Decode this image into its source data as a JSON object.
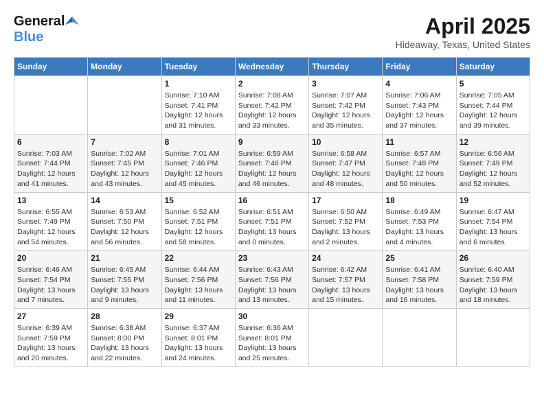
{
  "header": {
    "logo_general": "General",
    "logo_blue": "Blue",
    "month_title": "April 2025",
    "location": "Hideaway, Texas, United States"
  },
  "days_of_week": [
    "Sunday",
    "Monday",
    "Tuesday",
    "Wednesday",
    "Thursday",
    "Friday",
    "Saturday"
  ],
  "weeks": [
    [
      {
        "day": "",
        "info": ""
      },
      {
        "day": "",
        "info": ""
      },
      {
        "day": "1",
        "info": "Sunrise: 7:10 AM\nSunset: 7:41 PM\nDaylight: 12 hours\nand 31 minutes."
      },
      {
        "day": "2",
        "info": "Sunrise: 7:08 AM\nSunset: 7:42 PM\nDaylight: 12 hours\nand 33 minutes."
      },
      {
        "day": "3",
        "info": "Sunrise: 7:07 AM\nSunset: 7:42 PM\nDaylight: 12 hours\nand 35 minutes."
      },
      {
        "day": "4",
        "info": "Sunrise: 7:06 AM\nSunset: 7:43 PM\nDaylight: 12 hours\nand 37 minutes."
      },
      {
        "day": "5",
        "info": "Sunrise: 7:05 AM\nSunset: 7:44 PM\nDaylight: 12 hours\nand 39 minutes."
      }
    ],
    [
      {
        "day": "6",
        "info": "Sunrise: 7:03 AM\nSunset: 7:44 PM\nDaylight: 12 hours\nand 41 minutes."
      },
      {
        "day": "7",
        "info": "Sunrise: 7:02 AM\nSunset: 7:45 PM\nDaylight: 12 hours\nand 43 minutes."
      },
      {
        "day": "8",
        "info": "Sunrise: 7:01 AM\nSunset: 7:46 PM\nDaylight: 12 hours\nand 45 minutes."
      },
      {
        "day": "9",
        "info": "Sunrise: 6:59 AM\nSunset: 7:46 PM\nDaylight: 12 hours\nand 46 minutes."
      },
      {
        "day": "10",
        "info": "Sunrise: 6:58 AM\nSunset: 7:47 PM\nDaylight: 12 hours\nand 48 minutes."
      },
      {
        "day": "11",
        "info": "Sunrise: 6:57 AM\nSunset: 7:48 PM\nDaylight: 12 hours\nand 50 minutes."
      },
      {
        "day": "12",
        "info": "Sunrise: 6:56 AM\nSunset: 7:49 PM\nDaylight: 12 hours\nand 52 minutes."
      }
    ],
    [
      {
        "day": "13",
        "info": "Sunrise: 6:55 AM\nSunset: 7:49 PM\nDaylight: 12 hours\nand 54 minutes."
      },
      {
        "day": "14",
        "info": "Sunrise: 6:53 AM\nSunset: 7:50 PM\nDaylight: 12 hours\nand 56 minutes."
      },
      {
        "day": "15",
        "info": "Sunrise: 6:52 AM\nSunset: 7:51 PM\nDaylight: 12 hours\nand 58 minutes."
      },
      {
        "day": "16",
        "info": "Sunrise: 6:51 AM\nSunset: 7:51 PM\nDaylight: 13 hours\nand 0 minutes."
      },
      {
        "day": "17",
        "info": "Sunrise: 6:50 AM\nSunset: 7:52 PM\nDaylight: 13 hours\nand 2 minutes."
      },
      {
        "day": "18",
        "info": "Sunrise: 6:49 AM\nSunset: 7:53 PM\nDaylight: 13 hours\nand 4 minutes."
      },
      {
        "day": "19",
        "info": "Sunrise: 6:47 AM\nSunset: 7:54 PM\nDaylight: 13 hours\nand 6 minutes."
      }
    ],
    [
      {
        "day": "20",
        "info": "Sunrise: 6:46 AM\nSunset: 7:54 PM\nDaylight: 13 hours\nand 7 minutes."
      },
      {
        "day": "21",
        "info": "Sunrise: 6:45 AM\nSunset: 7:55 PM\nDaylight: 13 hours\nand 9 minutes."
      },
      {
        "day": "22",
        "info": "Sunrise: 6:44 AM\nSunset: 7:56 PM\nDaylight: 13 hours\nand 11 minutes."
      },
      {
        "day": "23",
        "info": "Sunrise: 6:43 AM\nSunset: 7:56 PM\nDaylight: 13 hours\nand 13 minutes."
      },
      {
        "day": "24",
        "info": "Sunrise: 6:42 AM\nSunset: 7:57 PM\nDaylight: 13 hours\nand 15 minutes."
      },
      {
        "day": "25",
        "info": "Sunrise: 6:41 AM\nSunset: 7:58 PM\nDaylight: 13 hours\nand 16 minutes."
      },
      {
        "day": "26",
        "info": "Sunrise: 6:40 AM\nSunset: 7:59 PM\nDaylight: 13 hours\nand 18 minutes."
      }
    ],
    [
      {
        "day": "27",
        "info": "Sunrise: 6:39 AM\nSunset: 7:59 PM\nDaylight: 13 hours\nand 20 minutes."
      },
      {
        "day": "28",
        "info": "Sunrise: 6:38 AM\nSunset: 8:00 PM\nDaylight: 13 hours\nand 22 minutes."
      },
      {
        "day": "29",
        "info": "Sunrise: 6:37 AM\nSunset: 8:01 PM\nDaylight: 13 hours\nand 24 minutes."
      },
      {
        "day": "30",
        "info": "Sunrise: 6:36 AM\nSunset: 8:01 PM\nDaylight: 13 hours\nand 25 minutes."
      },
      {
        "day": "",
        "info": ""
      },
      {
        "day": "",
        "info": ""
      },
      {
        "day": "",
        "info": ""
      }
    ]
  ]
}
